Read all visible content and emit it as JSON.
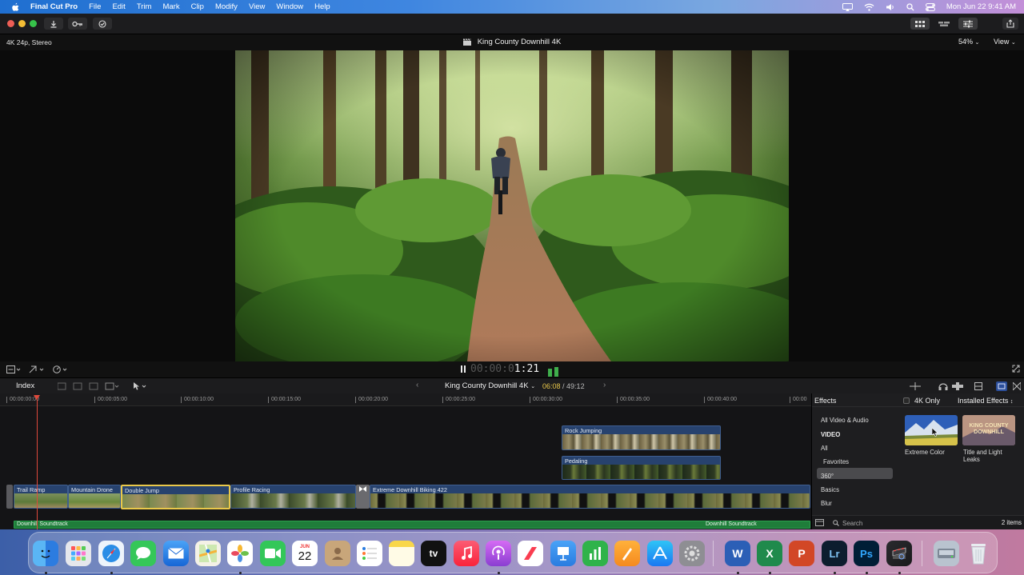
{
  "menubar": {
    "app": "Final Cut Pro",
    "items": [
      "File",
      "Edit",
      "Trim",
      "Mark",
      "Clip",
      "Modify",
      "View",
      "Window",
      "Help"
    ],
    "clock": "Mon Jun 22  9:41 AM"
  },
  "viewer": {
    "format": "4K 24p, Stereo",
    "title": "King County Downhill 4K",
    "zoom": "54%",
    "view": "View"
  },
  "transport": {
    "timecode_dim": "00:00:0",
    "timecode_lit": "1:21"
  },
  "timeline_header": {
    "index": "Index",
    "project": "King County Downhill 4K",
    "current": "06:08",
    "separator": " / ",
    "total": "49:12"
  },
  "ruler": {
    "ticks": [
      "00:00:00:00",
      "00:00:05:00",
      "00:00:10:00",
      "00:00:15:00",
      "00:00:20:00",
      "00:00:25:00",
      "00:00:30:00",
      "00:00:35:00",
      "00:00:40:00",
      "00:00"
    ]
  },
  "clips": {
    "connected": [
      "Rock Jumping",
      "Pedaling"
    ],
    "primary": [
      "Trail Ramp",
      "Mountain Drone",
      "Double Jump",
      "Profile Racing",
      "Extreme Downhill Biking 422"
    ],
    "audio": [
      "Downhill Soundtrack",
      "Downhill Soundtrack"
    ]
  },
  "effects": {
    "title": "Effects",
    "four_k_only": "4K Only",
    "installed": "Installed Effects",
    "categories": [
      "All Video & Audio",
      "VIDEO",
      "All",
      "Favorites",
      "360°",
      "Basics",
      "Blur"
    ],
    "selected_category": "Favorites",
    "items": [
      {
        "label": "Extreme Color",
        "label2": ""
      },
      {
        "label": "Title and Light",
        "label2": "Leaks"
      }
    ],
    "thumb_text": [
      "KING COUNTY",
      "DOWNHILL"
    ],
    "search_placeholder": "Search",
    "count": "2 items"
  },
  "dock": {
    "calendar_month": "JUN",
    "calendar_day": "22",
    "icons": [
      "finder-icon",
      "launchpad-icon",
      "safari-icon",
      "messages-icon",
      "mail-icon",
      "maps-icon",
      "photos-icon",
      "facetime-icon",
      "calendar-icon",
      "contacts-icon",
      "reminders-icon",
      "notes-icon",
      "apple-tv-icon",
      "music-icon",
      "podcasts-icon",
      "news-icon",
      "keynote-icon",
      "numbers-icon",
      "pages-icon",
      "app-store-icon",
      "system-preferences-icon",
      "word-icon",
      "excel-icon",
      "powerpoint-icon",
      "lightroom-icon",
      "photoshop-icon",
      "final-cut-pro-icon",
      "disk-utility-icon",
      "trash-icon"
    ],
    "letters": {
      "apple_tv": "tv",
      "word": "W",
      "excel": "X",
      "powerpoint": "P",
      "lightroom": "Lr",
      "photoshop": "Ps"
    }
  },
  "colors": {
    "accent_blue": "#27426e",
    "selection_yellow": "#e9c84a",
    "audio_green": "#1f7d3a",
    "playhead_red": "#e0493b"
  }
}
